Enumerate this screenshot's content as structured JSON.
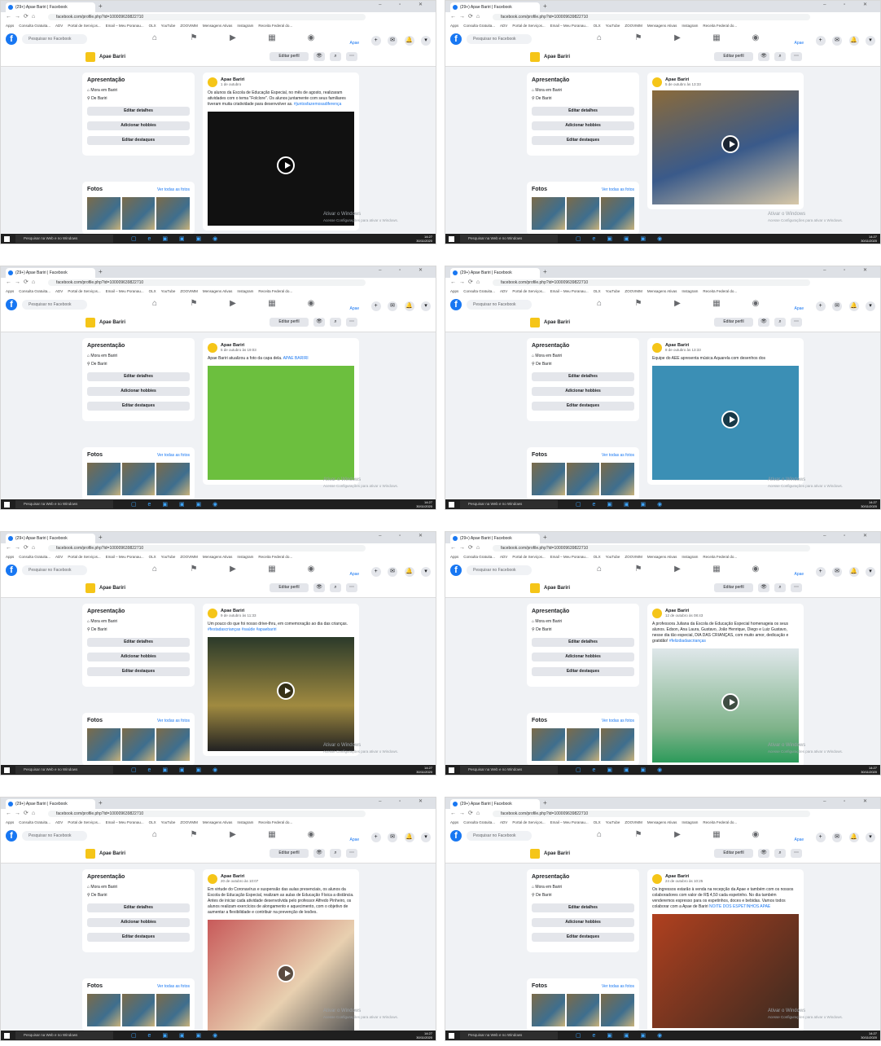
{
  "browser": {
    "tab_title": "(29+) Apae Bariri | Facebook",
    "url": "facebook.com/profile.php?id=100009639822710",
    "window_controls": "– ▫ ✕",
    "bookmarks": [
      "Apps",
      "Consulta Gratuita...",
      "ADV",
      "Portal de Serviços...",
      "Email – Meu Poranau...",
      "OLX",
      "YouTube",
      "ZOOVIMM",
      "Mensagens Ativas",
      "Instagram",
      "Receita Federal do..."
    ]
  },
  "facebook": {
    "search_placeholder": "Pesquisar no Facebook",
    "profile_name": "Apae Bariri",
    "user_short": "Apae",
    "edit_profile": "Editar perfil",
    "notif_badge": "20+"
  },
  "intro": {
    "title": "Apresentação",
    "lives_in": "Mora em Bariri",
    "from": "De Bariri",
    "btn_edit_details": "Editar detalhes",
    "btn_add_hobbies": "Adicionar hobbies",
    "btn_edit_featured": "Editar destaques"
  },
  "photos": {
    "title": "Fotos",
    "see_all": "Ver todas as fotos"
  },
  "posts": [
    {
      "author": "Apae Bariri",
      "time": "1 de outubro",
      "text": "Os alunos da Escola de Educação Especial, no mês de agosto, realizaram atividades com o tema \"Folclore\". Os alunos juntamente com seus familiares tiveram muita criatividade para desenvolver as.",
      "tags": "#juntosfazemosadiferença"
    },
    {
      "author": "Apae Bariri",
      "time": "5 de outubro às 13:33",
      "text": "",
      "tags": ""
    },
    {
      "author": "Apae Bariri",
      "time": "5 de outubro às 19:03",
      "text": "Apae Bariri atualizou a foto da capa dela.",
      "tags": "APAE BARIRI"
    },
    {
      "author": "Apae Bariri",
      "time": "8 de outubro às 13:33",
      "text": "Equipe do AEE apresenta música Aquarela com desenhos dos",
      "tags": ""
    },
    {
      "author": "Apae Bariri",
      "time": "9 de outubro às 11:33",
      "text": "Um pouco do que foi nosso drive-thru, em comemoração ao dia das crianças.",
      "tags": "#festadascrianças #saúde #apaebariri"
    },
    {
      "author": "Apae Bariri",
      "time": "12 de outubro às 08:43",
      "text": "A professora Juliana da Escola de Educação Especial homenageia os seus alunos. Edson, Ana Laura, Gustavo, João Henrique, Diego e Luiz Gustavo, nesse dia tão especial, DIA DAS CRIANÇAS, com muito amor, dedicação e gratidão!",
      "tags": "#felizdiadascrianças"
    },
    {
      "author": "Apae Bariri",
      "time": "20 de outubro às 10:07",
      "text": "Em virtude do Coronavírus e suspensão das aulas presenciais, os alunos da Escola de Educação Especial, realizam as aulas de Educação Física a distância. Antes de iniciar cada atividade desenvolvida pelo professor Alfredo Pinheiro, os alunos realizam exercícios de alongamento e aquecimento, com o objetivo de aumentar a flexibilidade e contribuir na prevenção de lesões.",
      "tags": ""
    },
    {
      "author": "Apae Bariri",
      "time": "24 de outubro às 10:25",
      "text": "Os ingressos estarão à venda na recepção da Apae e também com os nossos colaboradores com valor de R$ 4,50 cada espetinho. No dia também venderemos espresso para os espetinhos, doces e bebidas. Vamos todos colaborar com a Apae de Bariri",
      "tags": "NOITE DOS ESPETINHOS APAE"
    }
  ],
  "taskbar": {
    "search": "Pesquisar na Web e no Windows",
    "time": "14:27",
    "date": "30/11/2020"
  },
  "watermark": {
    "title": "Ativar o Windows",
    "sub": "Acesse Configurações para ativar o Windows."
  },
  "colors": {
    "fb_blue": "#1877f2",
    "bg": "#f0f2f5",
    "apae_green": "#6cbf3e"
  }
}
